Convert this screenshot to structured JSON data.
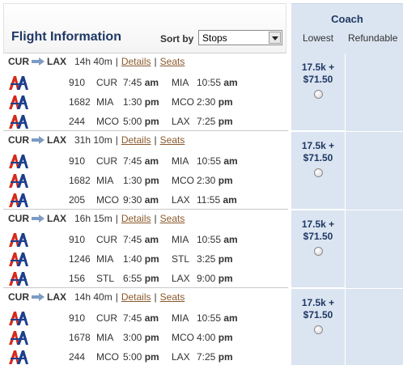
{
  "header": {
    "title": "Flight Information",
    "sort_label": "Sort by",
    "sort_value": "Stops"
  },
  "fare_header": {
    "cabin": "Coach",
    "col_lowest": "Lowest",
    "col_refundable": "Refundable"
  },
  "links": {
    "details": "Details",
    "seats": "Seats"
  },
  "icons": {
    "airline_logo": "american-airlines-logo",
    "route_arrow": "plane-arrow-icon",
    "sort_dropdown": "chevron-down-icon"
  },
  "colors": {
    "header_navy": "#1f3864",
    "fare_column_bg": "#dbe5f1",
    "link_brown": "#8b5a2b",
    "highlight_red": "#c00000",
    "logo_red": "#d52b1e",
    "logo_blue": "#1d3f8e"
  },
  "itineraries": [
    {
      "origin": "CUR",
      "destination": "LAX",
      "duration": "14h 40m",
      "separator": "|",
      "price_miles": "17.5k +",
      "price_cash": "$71.50",
      "segments": [
        {
          "flight": "910",
          "from": "CUR",
          "dep_time": "7:45",
          "dep_ampm": "am",
          "to": "MIA",
          "arr_time": "10:55",
          "arr_ampm": "am"
        },
        {
          "flight": "1682",
          "from": "MIA",
          "dep_time": "1:30",
          "dep_ampm": "pm",
          "to": "MCO",
          "arr_time": "2:30",
          "arr_ampm": "pm"
        },
        {
          "flight": "244",
          "from": "MCO",
          "dep_time": "5:00",
          "dep_ampm": "pm",
          "to": "LAX",
          "arr_time": "7:25",
          "arr_ampm": "pm"
        }
      ]
    },
    {
      "origin": "CUR",
      "destination": "LAX",
      "duration": "31h 10m",
      "separator": "|",
      "price_miles": "17.5k +",
      "price_cash": "$71.50",
      "segments": [
        {
          "flight": "910",
          "from": "CUR",
          "dep_time": "7:45",
          "dep_ampm": "am",
          "to": "MIA",
          "arr_time": "10:55",
          "arr_ampm": "am"
        },
        {
          "flight": "1682",
          "from": "MIA",
          "dep_time": "1:30",
          "dep_ampm": "pm",
          "to": "MCO",
          "arr_time": "2:30",
          "arr_ampm": "pm"
        },
        {
          "flight": "205",
          "from": "MCO",
          "dep_time": "9:30",
          "dep_ampm": "am",
          "to": "LAX",
          "arr_time": "11:55",
          "arr_ampm": "am",
          "dep_highlight": true
        }
      ]
    },
    {
      "origin": "CUR",
      "destination": "LAX",
      "duration": "16h 15m",
      "separator": "|",
      "price_miles": "17.5k +",
      "price_cash": "$71.50",
      "segments": [
        {
          "flight": "910",
          "from": "CUR",
          "dep_time": "7:45",
          "dep_ampm": "am",
          "to": "MIA",
          "arr_time": "10:55",
          "arr_ampm": "am"
        },
        {
          "flight": "1246",
          "from": "MIA",
          "dep_time": "1:40",
          "dep_ampm": "pm",
          "to": "STL",
          "arr_time": "3:25",
          "arr_ampm": "pm"
        },
        {
          "flight": "156",
          "from": "STL",
          "dep_time": "6:55",
          "dep_ampm": "pm",
          "to": "LAX",
          "arr_time": "9:00",
          "arr_ampm": "pm"
        }
      ]
    },
    {
      "origin": "CUR",
      "destination": "LAX",
      "duration": "14h 40m",
      "separator": "|",
      "price_miles": "17.5k +",
      "price_cash": "$71.50",
      "segments": [
        {
          "flight": "910",
          "from": "CUR",
          "dep_time": "7:45",
          "dep_ampm": "am",
          "to": "MIA",
          "arr_time": "10:55",
          "arr_ampm": "am"
        },
        {
          "flight": "1678",
          "from": "MIA",
          "dep_time": "3:00",
          "dep_ampm": "pm",
          "to": "MCO",
          "arr_time": "4:00",
          "arr_ampm": "pm"
        },
        {
          "flight": "244",
          "from": "MCO",
          "dep_time": "5:00",
          "dep_ampm": "pm",
          "to": "LAX",
          "arr_time": "7:25",
          "arr_ampm": "pm"
        }
      ]
    }
  ]
}
